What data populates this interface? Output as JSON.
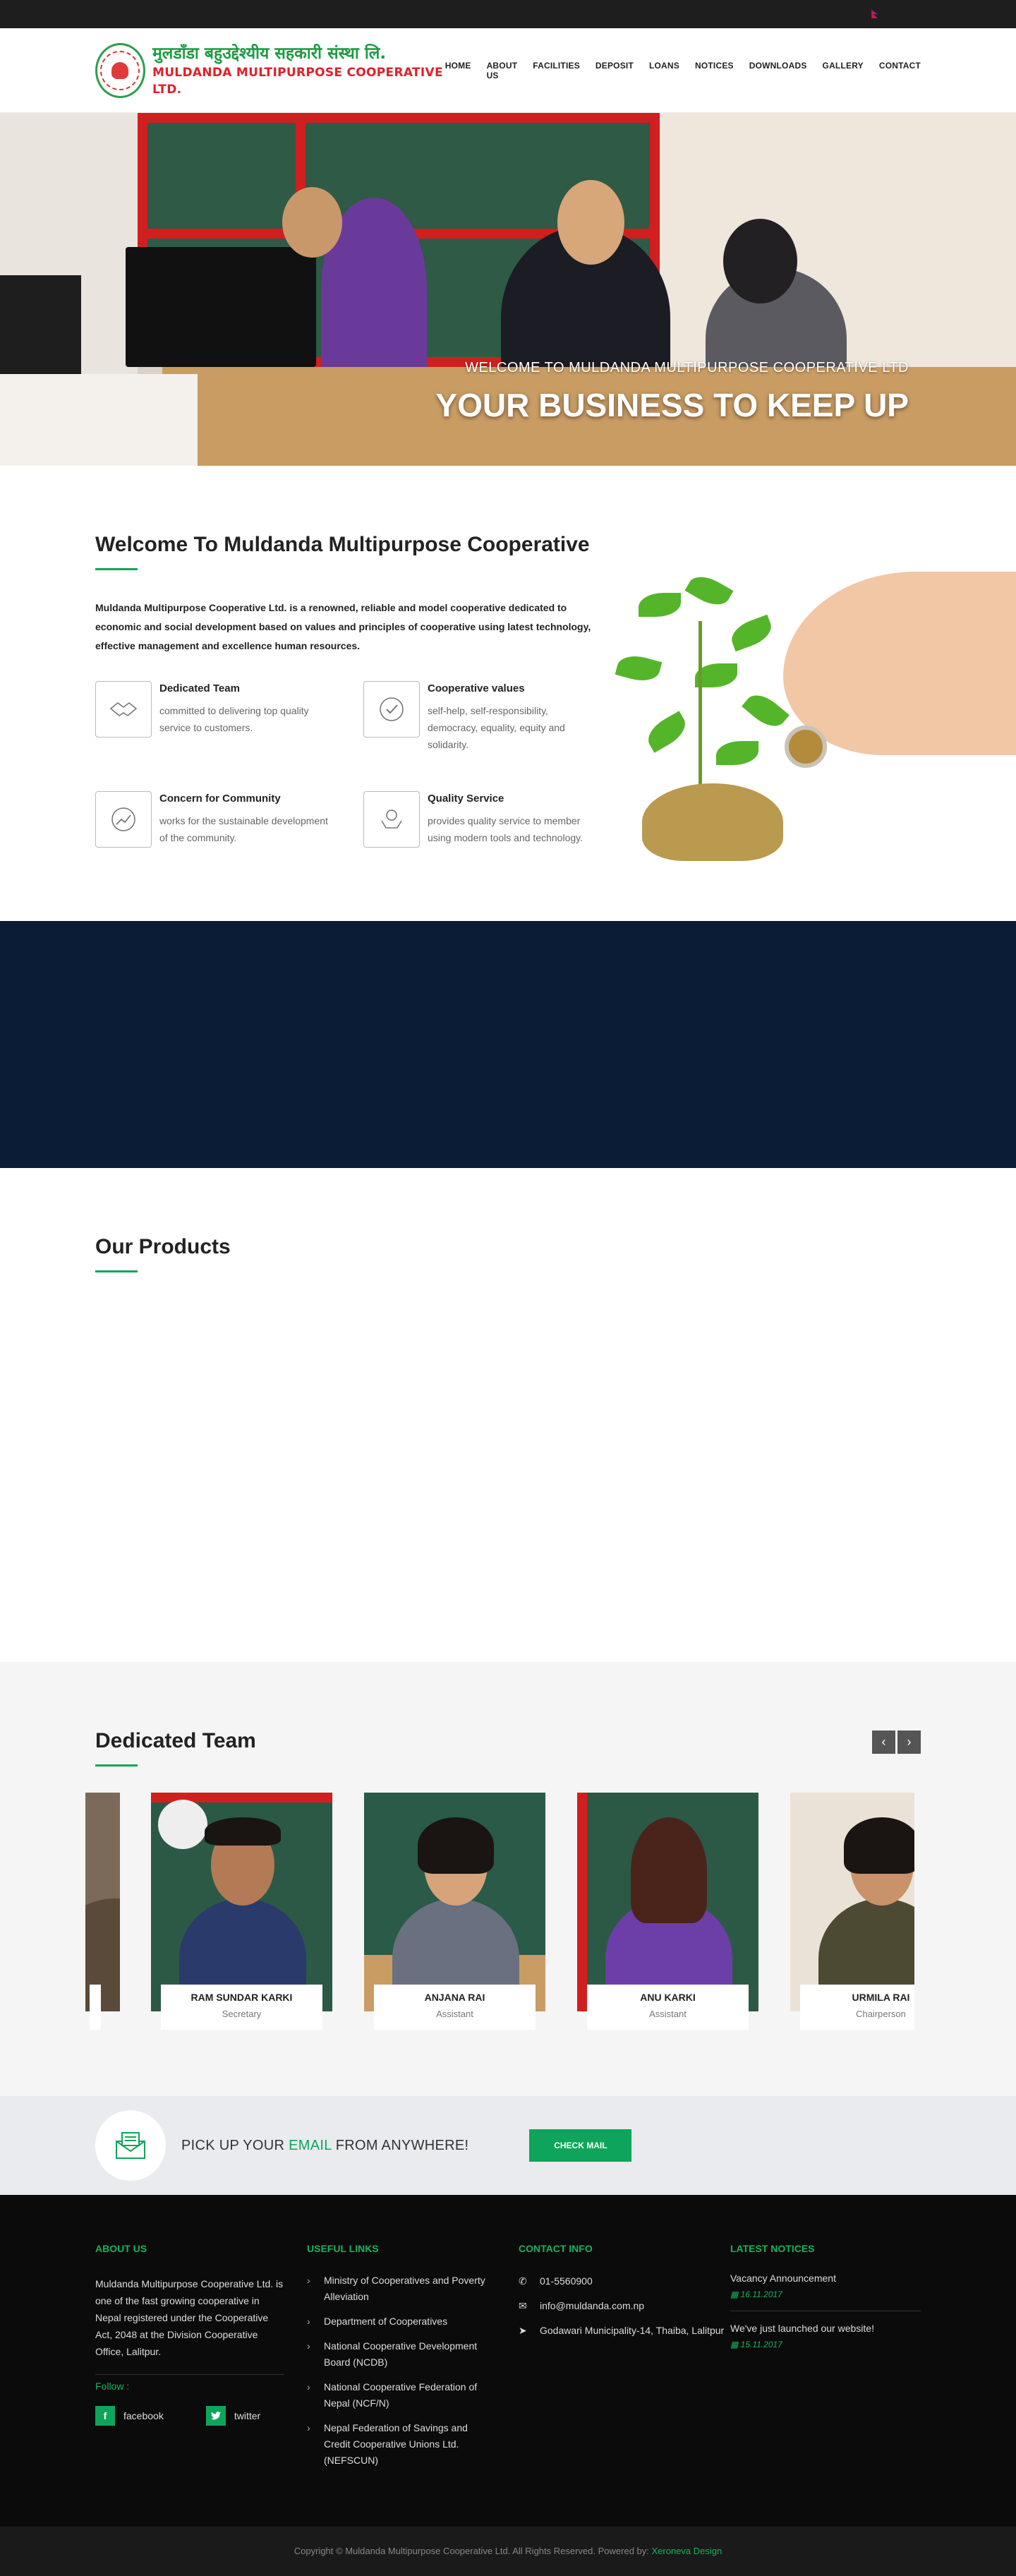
{
  "header": {
    "logo_nepali": "मुलडाँडा बहुउद्देश्यीय सहकारी संस्था लि.",
    "logo_english": "MULDANDA MULTIPURPOSE COOPERATIVE LTD.",
    "nav": [
      "HOME",
      "ABOUT US",
      "FACILITIES",
      "DEPOSIT",
      "LOANS",
      "NOTICES",
      "DOWNLOADS",
      "GALLERY",
      "CONTACT"
    ]
  },
  "hero": {
    "subtitle": "WELCOME TO MULDANDA MULTIPURPOSE COOPERATIVE LTD",
    "title": "YOUR BUSINESS TO KEEP UP"
  },
  "welcome": {
    "title": "Welcome To Muldanda Multipurpose Cooperative",
    "intro": "Muldanda Multipurpose Cooperative Ltd. is a renowned, reliable and model cooperative dedicated to economic and social development based on values and principles of cooperative using latest technology, effective management and excellence human resources.",
    "features": [
      {
        "icon": "handshake-icon",
        "title": "Dedicated Team",
        "desc": "committed to delivering top quality service to customers."
      },
      {
        "icon": "checkmark-badge-icon",
        "title": "Cooperative values",
        "desc": "self-help, self-responsibility, democracy, equality, equity and solidarity."
      },
      {
        "icon": "growth-chart-icon",
        "title": "Concern for Community",
        "desc": "works for the sustainable development of the community."
      },
      {
        "icon": "hands-money-icon",
        "title": "Quality Service",
        "desc": "provides quality service to member using modern tools and technology."
      }
    ]
  },
  "products": {
    "title": "Our Products"
  },
  "team": {
    "title": "Dedicated Team",
    "prev": "‹",
    "next": "›",
    "members": [
      {
        "name": "RAM SUNDAR KARKI",
        "role": "Secretary"
      },
      {
        "name": "ANJANA RAI",
        "role": "Assistant"
      },
      {
        "name": "ANU KARKI",
        "role": "Assistant"
      },
      {
        "name": "URMILA RAI",
        "role": "Chairperson"
      }
    ]
  },
  "email_strip": {
    "text_before": "PICK UP YOUR ",
    "highlight": "EMAIL",
    "text_after": " FROM ANYWHERE!",
    "button": "CHECK MAIL"
  },
  "footer": {
    "about_title": "ABOUT US",
    "about_text": "Muldanda Multipurpose Cooperative Ltd. is one of the fast growing cooperative in Nepal registered under the Cooperative Act, 2048 at the Division Cooperative Office, Lalitpur.",
    "follow": "Follow :",
    "facebook": "facebook",
    "twitter": "twitter",
    "links_title": "USEFUL LINKS",
    "links": [
      "Ministry of Cooperatives and Poverty Alleviation",
      "Department of Cooperatives",
      "National Cooperative Development Board (NCDB)",
      "National Cooperative Federation of Nepal (NCF/N)",
      "Nepal Federation of Savings and Credit Cooperative Unions Ltd. (NEFSCUN)"
    ],
    "contact_title": "CONTACT INFO",
    "phone": "01-5560900",
    "email": "info@muldanda.com.np",
    "address": "Godawari Municipality-14, Thaiba, Lalitpur",
    "notices_title": "LATEST NOTICES",
    "notices": [
      {
        "title": "Vacancy Announcement",
        "date": "16.11.2017"
      },
      {
        "title": "We've just launched our website!",
        "date": "15.11.2017"
      }
    ],
    "copyright": "Copyright © Muldanda Multipurpose Cooperative Ltd. All Rights Reserved. Powered by: ",
    "powered_by": "Xeroneva Design"
  },
  "colors": {
    "accent": "#0fa45b",
    "dark_band": "#0b1c36",
    "footer_bg": "#0b0b0b"
  }
}
